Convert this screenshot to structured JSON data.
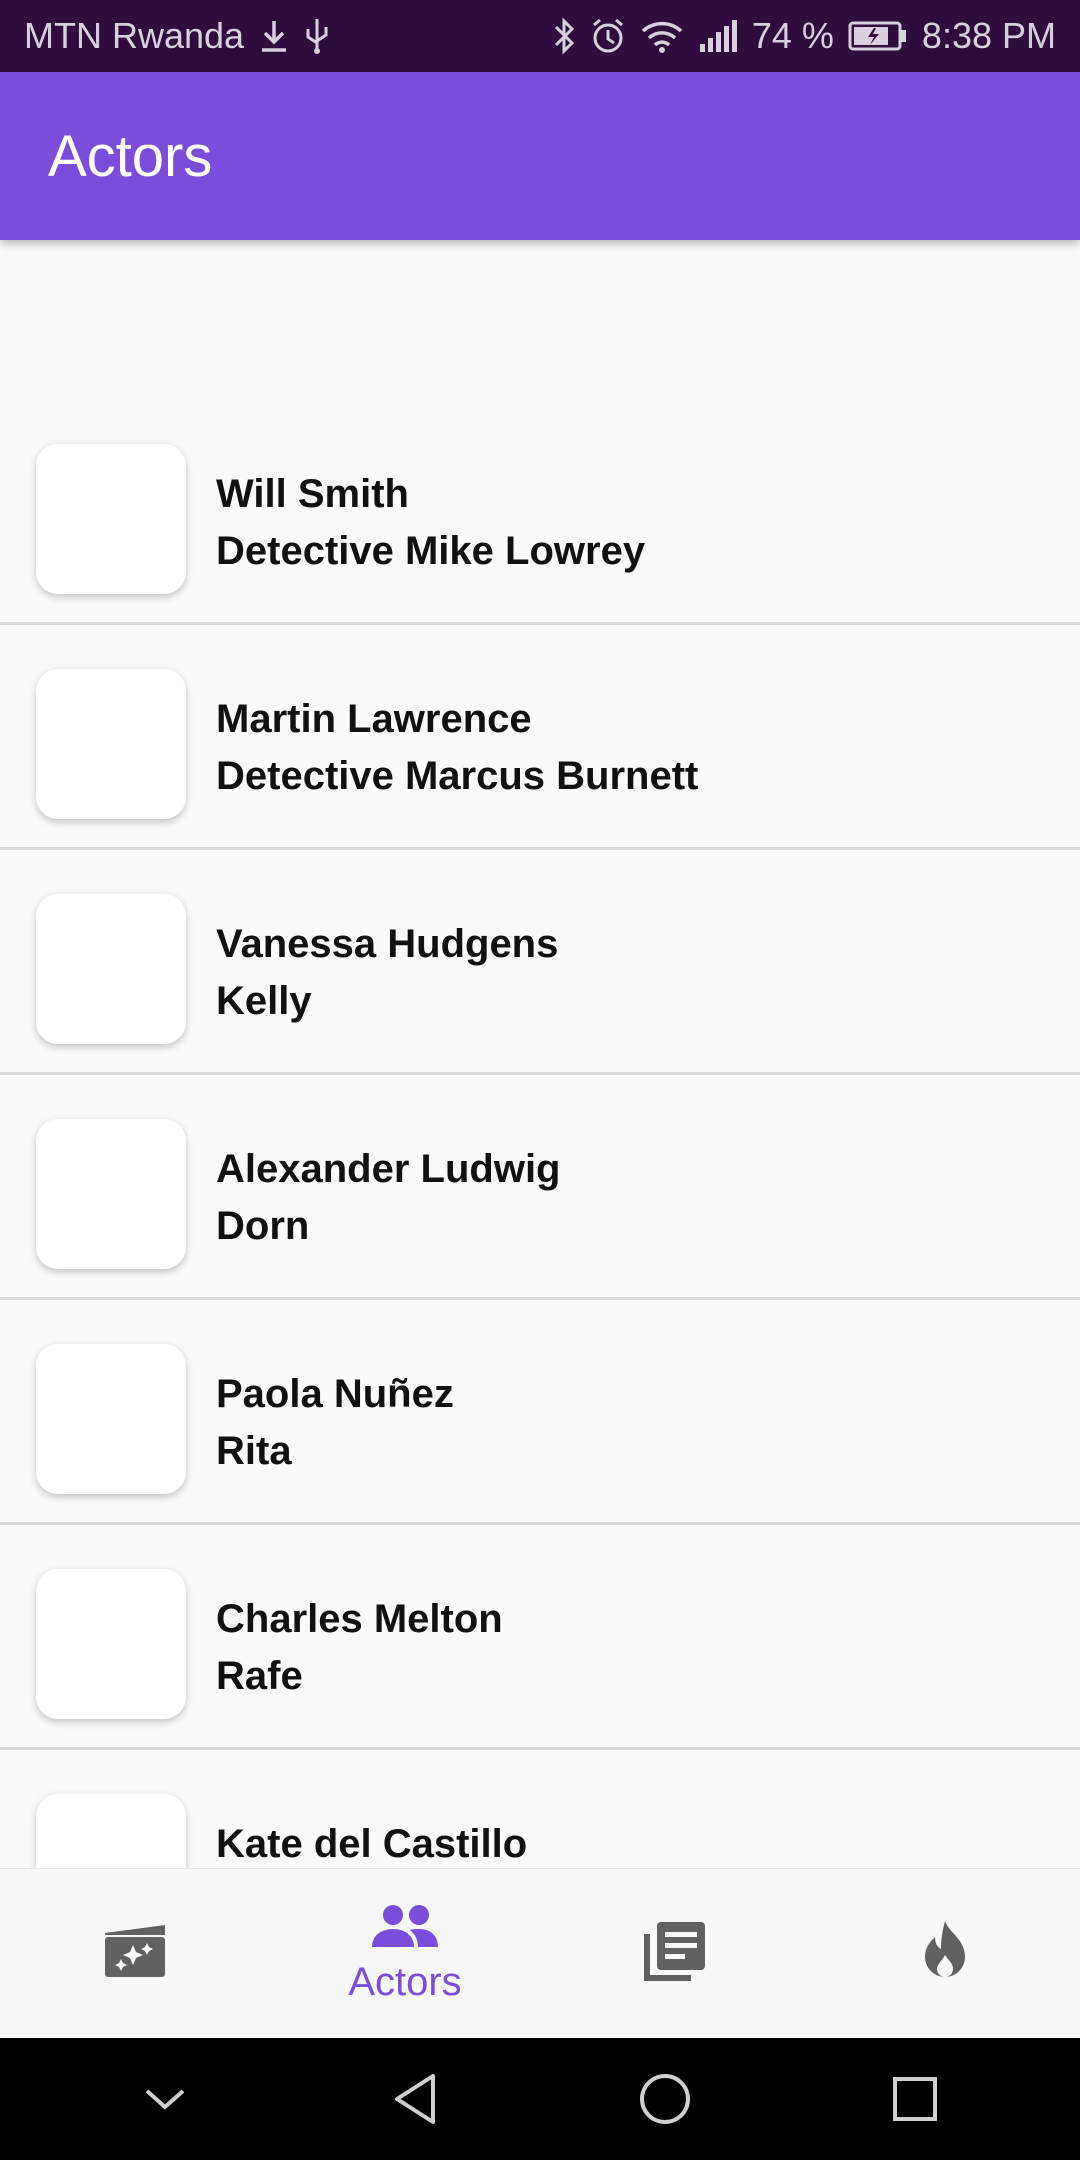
{
  "status_bar": {
    "carrier": "MTN Rwanda",
    "battery": "74 %",
    "time": "8:38 PM"
  },
  "app_bar": {
    "title": "Actors"
  },
  "actors": [
    {
      "name": "Will Smith",
      "character": "Detective Mike Lowrey"
    },
    {
      "name": "Martin Lawrence",
      "character": "Detective Marcus Burnett"
    },
    {
      "name": "Vanessa Hudgens",
      "character": "Kelly"
    },
    {
      "name": "Alexander Ludwig",
      "character": "Dorn"
    },
    {
      "name": "Paola Nuñez",
      "character": "Rita"
    },
    {
      "name": "Charles Melton",
      "character": "Rafe"
    },
    {
      "name": "Kate del Castillo",
      "character": ""
    }
  ],
  "bottom_nav": {
    "items": [
      {
        "icon": "movie-sparkle-icon",
        "label": ""
      },
      {
        "icon": "people-icon",
        "label": "Actors",
        "active": true
      },
      {
        "icon": "news-icon",
        "label": ""
      },
      {
        "icon": "fire-icon",
        "label": ""
      }
    ]
  },
  "colors": {
    "accent": "#7a4edb",
    "status_bar": "#300c3e",
    "inactive_icon": "#616161"
  }
}
